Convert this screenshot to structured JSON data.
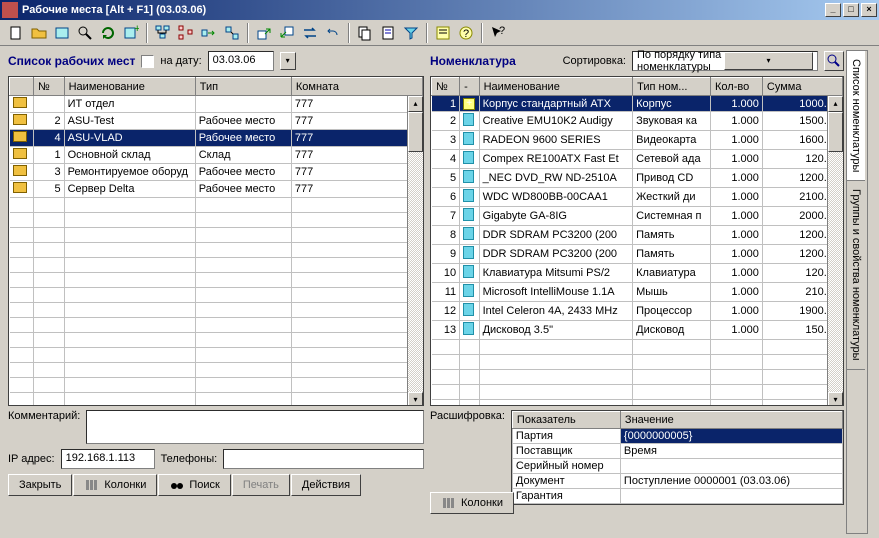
{
  "window": {
    "title": "Рабочие места [Alt + F1] (03.03.06)"
  },
  "left": {
    "title": "Список рабочих мест",
    "ondate_label": "на дату:",
    "date": "03.03.06",
    "cols": {
      "num": "№",
      "name": "Наименование",
      "type": "Тип",
      "room": "Комната"
    },
    "rows": [
      {
        "num": "",
        "name": "ИТ отдел",
        "type": "",
        "room": "777",
        "folder": true
      },
      {
        "num": "2",
        "name": "ASU-Test",
        "type": "Рабочее место",
        "room": "777",
        "folder": true
      },
      {
        "num": "4",
        "name": "ASU-VLAD",
        "type": "Рабочее место",
        "room": "777",
        "folder": true,
        "sel": true
      },
      {
        "num": "1",
        "name": "Основной склад",
        "type": "Склад",
        "room": "777",
        "folder": true
      },
      {
        "num": "3",
        "name": "Ремонтируемое оборуд",
        "type": "Рабочее место",
        "room": "777",
        "folder": true
      },
      {
        "num": "5",
        "name": "Сервер Delta",
        "type": "Рабочее место",
        "room": "777",
        "folder": true
      }
    ],
    "comment_lbl": "Комментарий:",
    "ip_lbl": "IP адрес:",
    "ip": "192.168.1.113",
    "tel_lbl": "Телефоны:",
    "btn_close": "Закрыть",
    "btn_cols": "Колонки",
    "btn_search": "Поиск",
    "btn_print": "Печать",
    "btn_actions": "Действия"
  },
  "right": {
    "title": "Номенклатура",
    "sort_lbl": "Сортировка:",
    "sort_val": "По порядку типа номенклатуры",
    "cols": {
      "num": "№",
      "dash": "-",
      "name": "Наименование",
      "type": "Тип ном...",
      "qty": "Кол-во",
      "sum": "Сумма"
    },
    "rows": [
      {
        "num": "1",
        "name": "Корпус стандартный ATX",
        "type": "Корпус",
        "qty": "1.000",
        "sum": "1000.00",
        "hi": true,
        "plus": true
      },
      {
        "num": "2",
        "name": "Creative EMU10K2 Audigy",
        "type": "Звуковая ка",
        "qty": "1.000",
        "sum": "1500.00"
      },
      {
        "num": "3",
        "name": "RADEON 9600 SERIES",
        "type": "Видеокарта",
        "qty": "1.000",
        "sum": "1600.00"
      },
      {
        "num": "4",
        "name": "Compex RE100ATX Fast Et",
        "type": "Сетевой ада",
        "qty": "1.000",
        "sum": "120.00"
      },
      {
        "num": "5",
        "name": "_NEC DVD_RW ND-2510A",
        "type": "Привод CD",
        "qty": "1.000",
        "sum": "1200.00"
      },
      {
        "num": "6",
        "name": "WDC WD800BB-00CAA1",
        "type": "Жесткий ди",
        "qty": "1.000",
        "sum": "2100.00"
      },
      {
        "num": "7",
        "name": "Gigabyte GA-8IG",
        "type": "Системная п",
        "qty": "1.000",
        "sum": "2000.00"
      },
      {
        "num": "8",
        "name": "DDR SDRAM PC3200 (200",
        "type": "Память",
        "qty": "1.000",
        "sum": "1200.00"
      },
      {
        "num": "9",
        "name": "DDR SDRAM PC3200 (200",
        "type": "Память",
        "qty": "1.000",
        "sum": "1200.00"
      },
      {
        "num": "10",
        "name": "Клавиатура Mitsumi PS/2",
        "type": "Клавиатура",
        "qty": "1.000",
        "sum": "120.00"
      },
      {
        "num": "11",
        "name": "Microsoft IntelliMouse 1.1A",
        "type": "Мышь",
        "qty": "1.000",
        "sum": "210.00"
      },
      {
        "num": "12",
        "name": "Intel Celeron 4A, 2433 MHz",
        "type": "Процессор",
        "qty": "1.000",
        "sum": "1900.00"
      },
      {
        "num": "13",
        "name": "Дисковод 3.5\"",
        "type": "Дисковод",
        "qty": "1.000",
        "sum": "150.00"
      }
    ],
    "decode_lbl": "Расшифровка:",
    "det_cols": {
      "k": "Показатель",
      "v": "Значение"
    },
    "details": [
      {
        "k": "Партия",
        "v": "{0000000005}",
        "sel": true
      },
      {
        "k": "Поставщик",
        "v": "Время"
      },
      {
        "k": "Серийный номер",
        "v": ""
      },
      {
        "k": "Документ",
        "v": "Поступление 0000001 (03.03.06)"
      },
      {
        "k": "Гарантия",
        "v": ""
      }
    ],
    "btn_cols": "Колонки"
  },
  "sidetabs": {
    "t1": "Список номенклатуры",
    "t2": "Группы и свойства номенклатуры"
  }
}
